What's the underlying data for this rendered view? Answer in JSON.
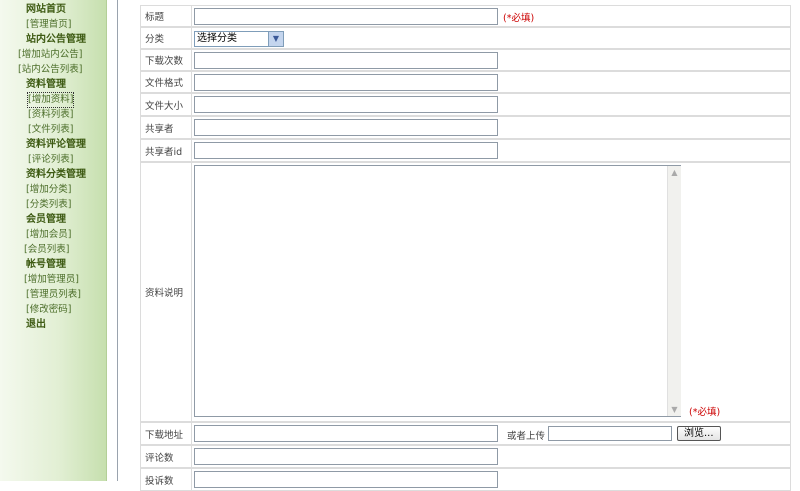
{
  "sidebar": {
    "items": [
      {
        "label": "网站首页",
        "kind": "head"
      },
      {
        "label": "[管理首页]",
        "kind": "link"
      },
      {
        "label": "站内公告管理",
        "kind": "head"
      },
      {
        "label": "[增加站内公告]",
        "kind": "link"
      },
      {
        "label": "[站内公告列表]",
        "kind": "link"
      },
      {
        "label": "资料管理",
        "kind": "head"
      },
      {
        "label": "[增加资料]",
        "kind": "link",
        "selected": true
      },
      {
        "label": "[资料列表]",
        "kind": "link"
      },
      {
        "label": "[文件列表]",
        "kind": "link"
      },
      {
        "label": "资料评论管理",
        "kind": "head"
      },
      {
        "label": "[评论列表]",
        "kind": "link"
      },
      {
        "label": "资料分类管理",
        "kind": "head"
      },
      {
        "label": "[增加分类]",
        "kind": "link"
      },
      {
        "label": "[分类列表]",
        "kind": "link"
      },
      {
        "label": "会员管理",
        "kind": "head"
      },
      {
        "label": "[增加会员]",
        "kind": "link"
      },
      {
        "label": "[会员列表]",
        "kind": "link"
      },
      {
        "label": "帐号管理",
        "kind": "head"
      },
      {
        "label": "[增加管理员]",
        "kind": "link"
      },
      {
        "label": "[管理员列表]",
        "kind": "link"
      },
      {
        "label": "[修改密码]",
        "kind": "link"
      },
      {
        "label": "退出",
        "kind": "head"
      }
    ]
  },
  "form": {
    "title_label": "标题",
    "title_value": "",
    "required_mark": "(*必填)",
    "category_label": "分类",
    "category_selected": "选择分类",
    "downloads_label": "下载次数",
    "downloads_value": "",
    "format_label": "文件格式",
    "format_value": "",
    "size_label": "文件大小",
    "size_value": "",
    "sharer_label": "共享者",
    "sharer_value": "",
    "sharer_id_label": "共享者id",
    "sharer_id_value": "",
    "description_label": "资料说明",
    "description_value": "",
    "download_url_label": "下载地址",
    "download_url_value": "",
    "upload_label": "或者上传",
    "browse_button": "浏览...",
    "comments_label": "评论数",
    "comments_value": "",
    "complaints_label": "投诉数",
    "complaints_value": ""
  },
  "colors": {
    "required": "#cc0000",
    "sidebar_head": "#3d5a12",
    "sidebar_link": "#4c6e2a"
  }
}
